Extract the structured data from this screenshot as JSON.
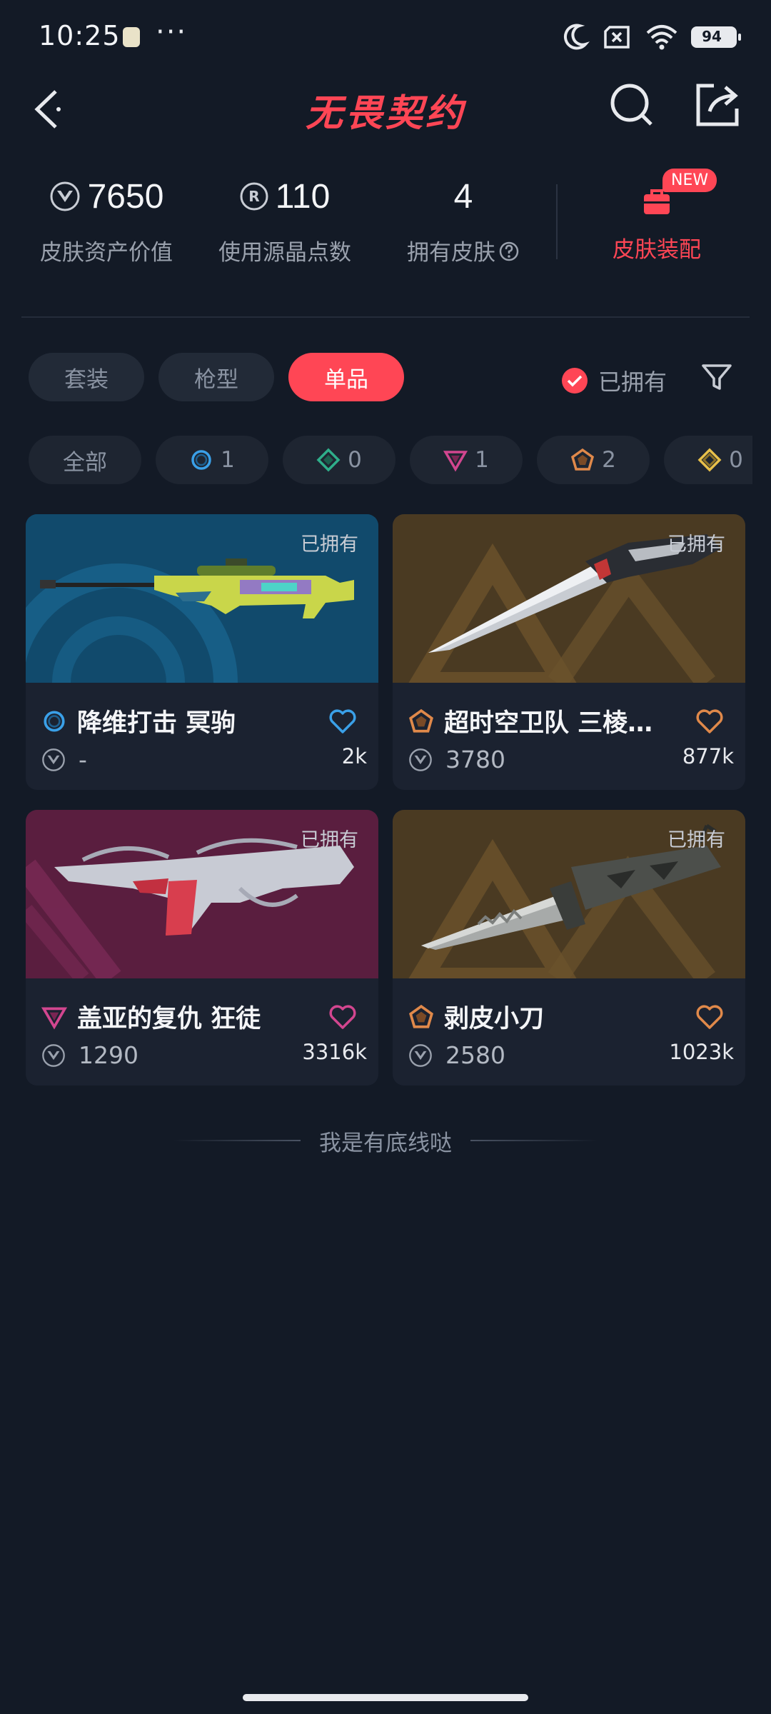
{
  "status_bar": {
    "time": "10:25",
    "more": "···",
    "battery": "94",
    "icons": [
      "moon-icon",
      "sim-off-icon",
      "wifi-icon",
      "battery-icon"
    ]
  },
  "header": {
    "logo_text": "无畏契约",
    "icons": [
      "back-arrow-icon",
      "search-icon",
      "share-icon"
    ]
  },
  "stats": {
    "asset_value": "7650",
    "asset_label": "皮肤资产价值",
    "radiant_points": "110",
    "radiant_label": "使用源晶点数",
    "owned_count": "4",
    "owned_label": "拥有皮肤",
    "equip_label": "皮肤装配",
    "new_badge": "NEW"
  },
  "tabs": [
    {
      "label": "套装",
      "active": false
    },
    {
      "label": "枪型",
      "active": false
    },
    {
      "label": "单品",
      "active": true
    }
  ],
  "owned_filter": {
    "label": "已拥有",
    "checked": true
  },
  "tier_chips": [
    {
      "label": "全部",
      "count": ""
    },
    {
      "tier": "select",
      "count": "1"
    },
    {
      "tier": "deluxe",
      "count": "0"
    },
    {
      "tier": "premium",
      "count": "1"
    },
    {
      "tier": "exclusive",
      "count": "2"
    },
    {
      "tier": "ultra",
      "count": "0"
    }
  ],
  "colors": {
    "accent": "#ff4655",
    "select": "#3aa0e8",
    "deluxe": "#2fae8a",
    "premium": "#d2468f",
    "exclusive": "#e0894a",
    "ultra": "#e8c04a",
    "background": "#131a26"
  },
  "cards": [
    {
      "owned_label": "已拥有",
      "name": "降维打击 冥驹",
      "tier": "select",
      "price": "-",
      "likes": "2k",
      "liked": false
    },
    {
      "owned_label": "已拥有",
      "name": "超时空卫队 三棱…",
      "tier": "exclusive",
      "price": "3780",
      "likes": "877k",
      "liked": false
    },
    {
      "owned_label": "已拥有",
      "name": "盖亚的复仇 狂徒",
      "tier": "premium",
      "price": "1290",
      "likes": "3316k",
      "liked": false
    },
    {
      "owned_label": "已拥有",
      "name": "剥皮小刀",
      "tier": "exclusive",
      "price": "2580",
      "likes": "1023k",
      "liked": false
    }
  ],
  "footer_note": "我是有底线哒"
}
